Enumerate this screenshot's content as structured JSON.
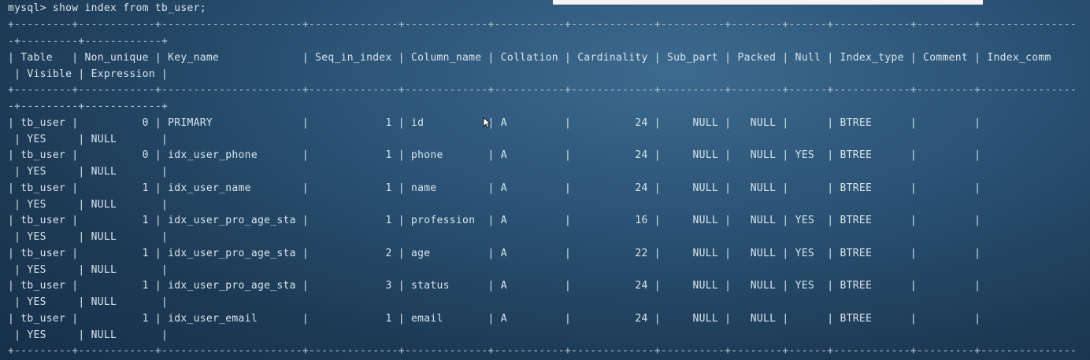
{
  "terminal": {
    "prompt": "mysql> show index from tb_user;",
    "border_long": "+---------+------------+----------------------+--------------+-------------+-----------+-------------+----------+--------+------+------------+---------+---------------",
    "border_short": "-+---------+------------+",
    "header_line1": "| Table   | Non_unique | Key_name             | Seq_in_index | Column_name | Collation | Cardinality | Sub_part | Packed | Null | Index_type | Comment | Index_comm",
    "header_line2": " | Visible | Expression |",
    "rows": [
      {
        "line1": "| tb_user |          0 | PRIMARY              |            1 | id          | A         |          24 |     NULL |   NULL |      | BTREE      |         |",
        "line2": " | YES     | NULL       |"
      },
      {
        "line1": "| tb_user |          0 | idx_user_phone       |            1 | phone       | A         |          24 |     NULL |   NULL | YES  | BTREE      |         |",
        "line2": " | YES     | NULL       |"
      },
      {
        "line1": "| tb_user |          1 | idx_user_name        |            1 | name        | A         |          24 |     NULL |   NULL |      | BTREE      |         |",
        "line2": " | YES     | NULL       |"
      },
      {
        "line1": "| tb_user |          1 | idx_user_pro_age_sta |            1 | profession  | A         |          16 |     NULL |   NULL | YES  | BTREE      |         |",
        "line2": " | YES     | NULL       |"
      },
      {
        "line1": "| tb_user |          1 | idx_user_pro_age_sta |            2 | age         | A         |          22 |     NULL |   NULL | YES  | BTREE      |         |",
        "line2": " | YES     | NULL       |"
      },
      {
        "line1": "| tb_user |          1 | idx_user_pro_age_sta |            3 | status      | A         |          24 |     NULL |   NULL | YES  | BTREE      |         |",
        "line2": " | YES     | NULL       |"
      },
      {
        "line1": "| tb_user |          1 | idx_user_email       |            1 | email       | A         |          24 |     NULL |   NULL |      | BTREE      |         |",
        "line2": " | YES     | NULL       |"
      }
    ]
  },
  "icons": {
    "mouse_cursor": "mouse-cursor-icon"
  },
  "colors": {
    "background": "#24455f",
    "text": "#d9e4ec"
  }
}
